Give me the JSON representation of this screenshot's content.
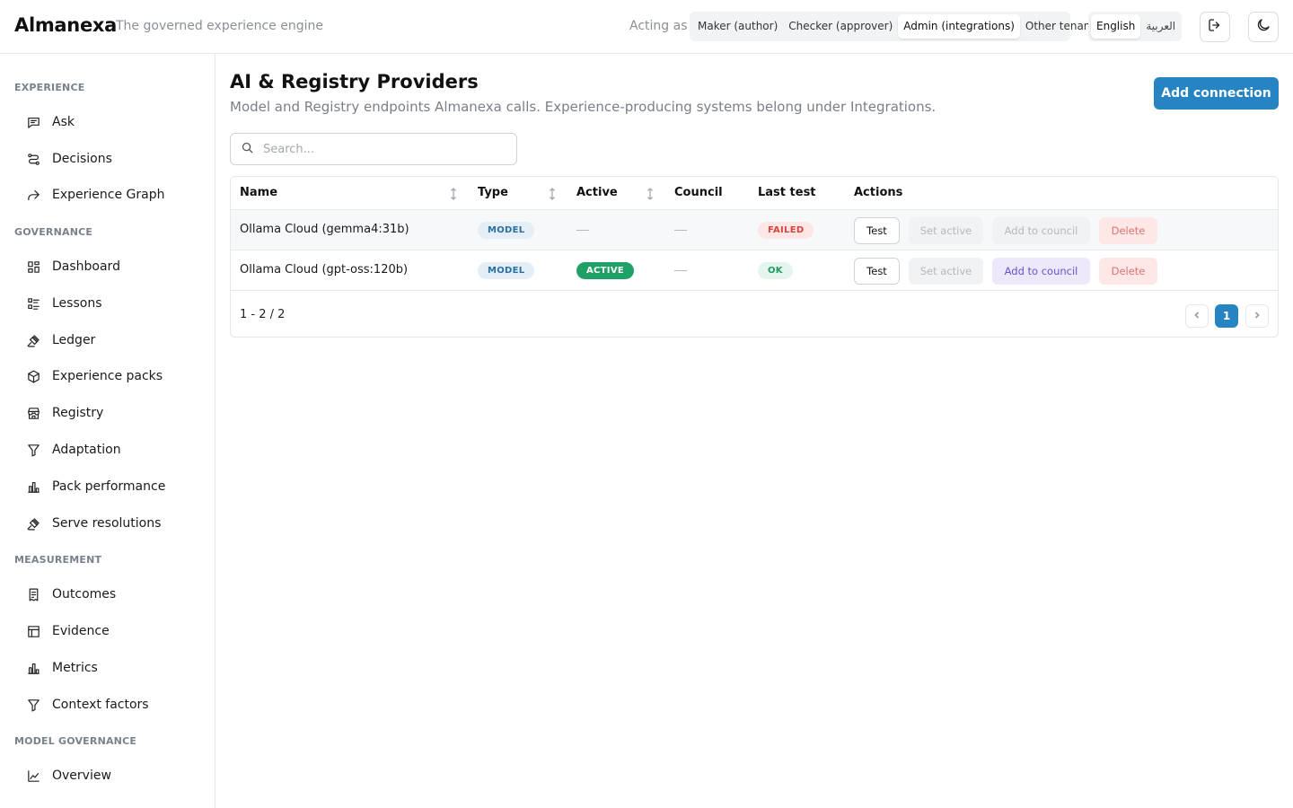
{
  "header": {
    "brand": "Almanexa",
    "tagline": "The governed experience engine",
    "acting_label": "Acting as",
    "roles": [
      "Maker (author)",
      "Checker (approver)",
      "Admin (integrations)",
      "Other tenant"
    ],
    "selected_role": "Admin (integrations)",
    "languages": [
      "English",
      "العربية"
    ],
    "selected_language": "English",
    "logout_icon": "logout-icon",
    "theme_icon": "moon-icon"
  },
  "sidebar": {
    "sections": [
      {
        "title": "EXPERIENCE",
        "items": [
          "Ask",
          "Decisions",
          "Experience Graph"
        ]
      },
      {
        "title": "GOVERNANCE",
        "items": [
          "Dashboard",
          "Lessons",
          "Ledger",
          "Experience packs",
          "Registry",
          "Adaptation",
          "Pack performance",
          "Serve resolutions"
        ]
      },
      {
        "title": "MEASUREMENT",
        "items": [
          "Outcomes",
          "Evidence",
          "Metrics",
          "Context factors"
        ]
      },
      {
        "title": "MODEL GOVERNANCE",
        "items": [
          "Overview"
        ]
      }
    ]
  },
  "main": {
    "title": "AI & Registry Providers",
    "subtitle": "Model and Registry endpoints Almanexa calls. Experience-producing systems belong under Integrations.",
    "add_button": "Add connection",
    "search_placeholder": "Search...",
    "columns": [
      "Name",
      "Type",
      "Active",
      "Council",
      "Last test",
      "Actions"
    ],
    "rows": [
      {
        "name": "Ollama Cloud (gemma4:31b)",
        "type": "MODEL",
        "active": "",
        "council": "",
        "last_test": "FAILED",
        "actions": [
          "Test",
          "Set active",
          "Add to council",
          "Delete"
        ]
      },
      {
        "name": "Ollama Cloud (gpt-oss:120b)",
        "type": "MODEL",
        "active": "ACTIVE",
        "council": "",
        "last_test": "OK",
        "actions": [
          "Test",
          "Set active",
          "Add to council",
          "Delete"
        ]
      }
    ],
    "pagination": {
      "summary": "1 - 2 / 2",
      "current_page": "1"
    }
  },
  "colors": {
    "accent": "#2684c2",
    "active_badge": "#1fa067",
    "failed_text": "#d6453d",
    "council_text": "#6c4fd0"
  }
}
